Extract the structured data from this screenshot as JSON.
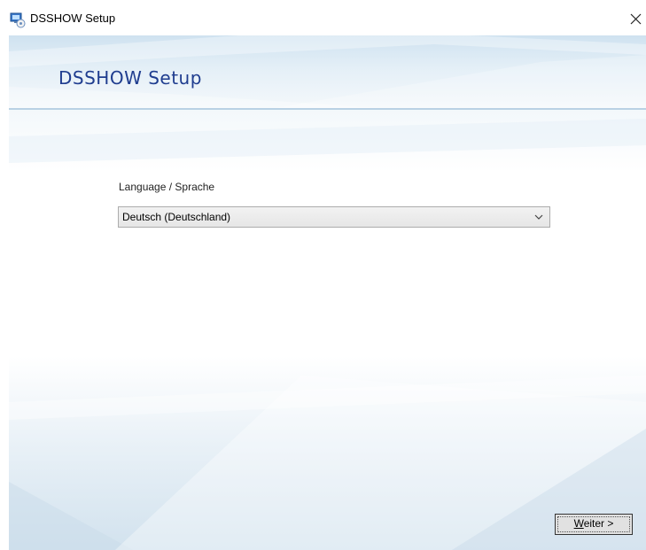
{
  "window": {
    "title": "DSSHOW Setup",
    "icon": "setup-installer-icon",
    "close_icon": "close-icon"
  },
  "header": {
    "title": "DSSHOW Setup"
  },
  "language": {
    "label": "Language / Sprache",
    "selected": "Deutsch (Deutschland)"
  },
  "footer": {
    "next_button_access_key": "W",
    "next_button_rest": "eiter >"
  },
  "colors": {
    "header_title": "#1f3d8f",
    "header_band": "#d8e8f3",
    "button_face": "#e1e1e1"
  }
}
